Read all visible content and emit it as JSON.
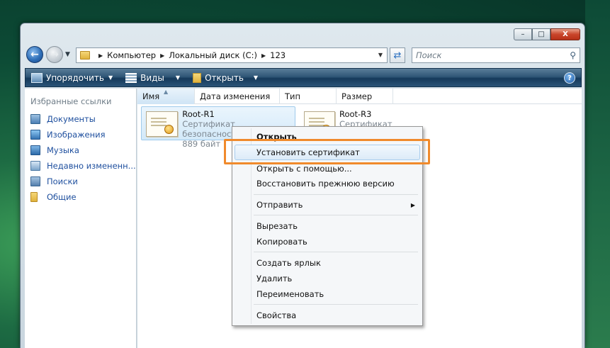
{
  "window": {
    "buttons": {
      "minimize": "–",
      "maximize": "□",
      "close": "X"
    }
  },
  "address_bar": {
    "crumbs": [
      "Компьютер",
      "Локальный диск (C:)",
      "123"
    ],
    "search_placeholder": "Поиск"
  },
  "toolbar": {
    "organize": "Упорядочить",
    "views": "Виды",
    "open": "Открыть",
    "help": "?"
  },
  "left_pane": {
    "title": "Избранные ссылки",
    "items": [
      {
        "label": "Документы",
        "icon": "documents-icon"
      },
      {
        "label": "Изображения",
        "icon": "pictures-icon"
      },
      {
        "label": "Музыка",
        "icon": "music-icon"
      },
      {
        "label": "Недавно измененн...",
        "icon": "recent-icon"
      },
      {
        "label": "Поиски",
        "icon": "searches-icon"
      },
      {
        "label": "Общие",
        "icon": "public-folder-icon"
      }
    ]
  },
  "columns": [
    "Имя",
    "Дата изменения",
    "Тип",
    "Размер"
  ],
  "files": [
    {
      "name": "Root-R1",
      "type": "Сертификат безопасности",
      "size": "889 байт",
      "selected": true
    },
    {
      "name": "Root-R3",
      "type": "Сертификат безопасности",
      "selected": false
    }
  ],
  "context_menu": {
    "items": [
      "Открыть",
      "Установить сертификат",
      "Открыть с помощью...",
      "Восстановить прежнюю версию",
      "Отправить",
      "Вырезать",
      "Копировать",
      "Создать ярлык",
      "Удалить",
      "Переименовать",
      "Свойства"
    ]
  },
  "colors": {
    "highlight_frame": "#f08a2c",
    "link_blue": "#1e4f9e",
    "toolbar_dark": "#163a5b"
  }
}
